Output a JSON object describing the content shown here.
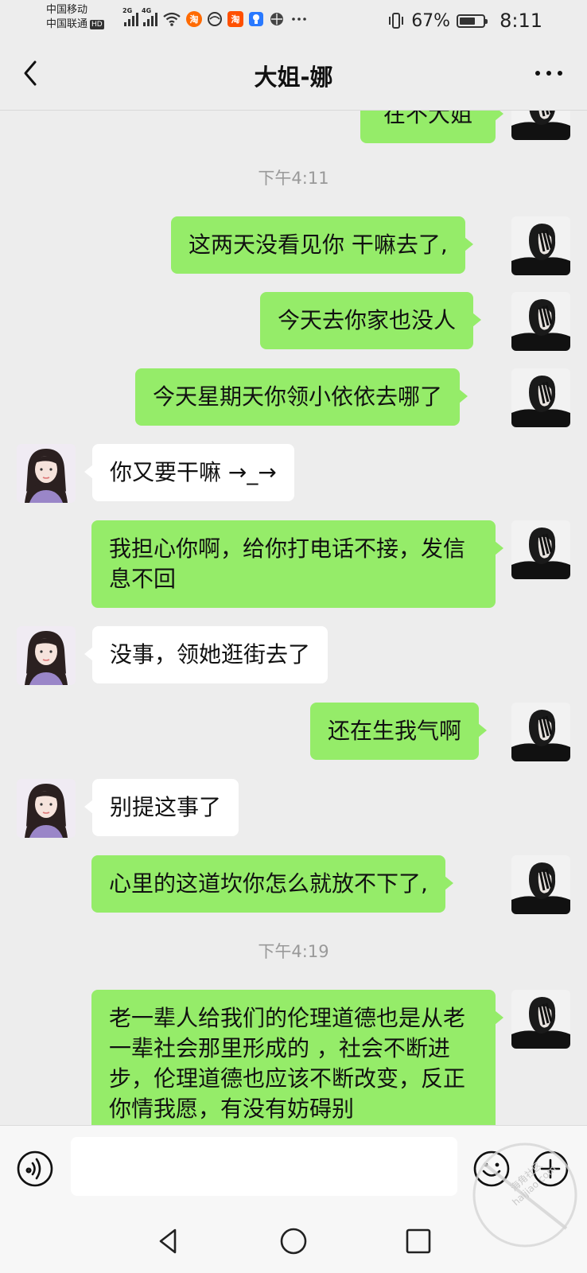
{
  "status_bar": {
    "carrier_1": "中国移动",
    "carrier_2": "中国联通",
    "hd_badge": "HD",
    "net_1": "2G",
    "net_2": "4G",
    "app_icon_1": "淘",
    "app_icon_2": "淘",
    "battery_percent": "67%",
    "battery_level": 0.67,
    "time": "8:11"
  },
  "header": {
    "title": "大姐-娜",
    "back_icon": "chevron-left-icon",
    "more_icon": "more-dots-icon"
  },
  "messages": [
    {
      "sender": "me",
      "text": "在不大姐"
    },
    {
      "type": "time",
      "text": "下午4:11"
    },
    {
      "sender": "me",
      "text": "这两天没看见你 干嘛去了,"
    },
    {
      "sender": "me",
      "text": "今天去你家也没人"
    },
    {
      "sender": "me",
      "text": "今天星期天你领小依依去哪了"
    },
    {
      "sender": "them",
      "text": "你又要干嘛 →_→"
    },
    {
      "sender": "me",
      "text": "我担心你啊，给你打电话不接，发信息不回"
    },
    {
      "sender": "them",
      "text": "没事，领她逛街去了"
    },
    {
      "sender": "me",
      "text": "还在生我气啊"
    },
    {
      "sender": "them",
      "text": "别提这事了"
    },
    {
      "sender": "me",
      "text": "心里的这道坎你怎么就放不下了,"
    },
    {
      "type": "time",
      "text": "下午4:19"
    },
    {
      "sender": "me",
      "text": "老一辈人给我们的伦理道德也是从老一辈社会那里形成的 ，社会不断进步，伦理道德也应该不断改变，反正你情我愿，有没有妨碍别"
    }
  ],
  "input_bar": {
    "voice_icon": "voice-icon",
    "text_value": "",
    "emoji_icon": "emoji-icon",
    "plus_icon": "plus-icon"
  },
  "system_nav": {
    "back_icon": "triangle-back-icon",
    "home_icon": "circle-home-icon",
    "recents_icon": "square-recents-icon"
  },
  "watermark": {
    "text": "haijiao.com",
    "label": "海角社区"
  },
  "colors": {
    "background": "#ededed",
    "my_bubble": "#95ec69",
    "their_bubble": "#ffffff",
    "timestamp": "#999999"
  }
}
